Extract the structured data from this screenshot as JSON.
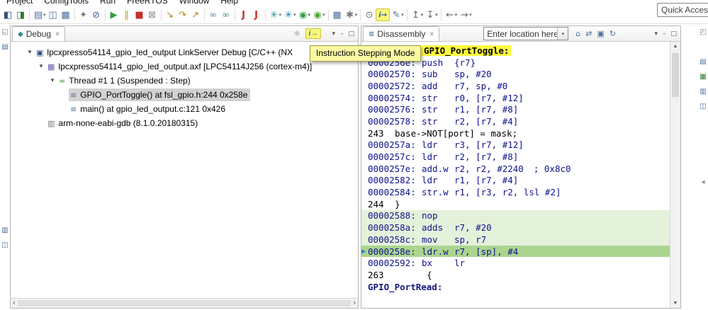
{
  "menu": {
    "items": [
      {
        "label": "Project"
      },
      {
        "label": "ConfigTools"
      },
      {
        "label": "Run"
      },
      {
        "label": "FreeRTOS"
      },
      {
        "label": "Window"
      },
      {
        "label": "Help"
      }
    ]
  },
  "quick_access": {
    "label": "Quick Access"
  },
  "glyphs": {
    "caret_down": "▾",
    "expanded": "▾",
    "close": "×",
    "scroll_left": "‹",
    "scroll_right": "›",
    "scroll_up": "▲",
    "scroll_down": "▼",
    "current_arrow": "▶",
    "debug_tab": "◆",
    "disassembly_tab": "≡",
    "dim_tool": "✱",
    "step_mode": "i→"
  },
  "window_buttons": [
    {
      "name": "view-menu",
      "glyph": "▾"
    },
    {
      "name": "minimize-view",
      "glyph": "–"
    },
    {
      "name": "maximize-view",
      "glyph": "□"
    }
  ],
  "main_toolbar": {
    "icons": [
      {
        "name": "open-debug-config",
        "glyph": "◧",
        "color": "#35517d"
      },
      {
        "name": "open-run-config",
        "glyph": "◨",
        "color": "#2e7d32"
      },
      {
        "name": "new-wizard",
        "glyph": "▤",
        "color": "#4a6fa0",
        "caret": true,
        "sep": true
      },
      {
        "name": "save",
        "glyph": "◫",
        "color": "#4a6fa0"
      },
      {
        "name": "save-all",
        "glyph": "▩",
        "color": "#4a6fa0"
      },
      {
        "name": "build",
        "glyph": "✦",
        "color": "#777777",
        "sep": true
      },
      {
        "name": "skip-all-breakpoints",
        "glyph": "⊘",
        "color": "#3b5ea8"
      },
      {
        "name": "resume",
        "glyph": "▶",
        "color": "#2f9e44",
        "sep": true
      },
      {
        "name": "suspend",
        "glyph": "‖",
        "color": "#caa21f"
      },
      {
        "name": "terminate",
        "glyph": "■",
        "color": "#c4302b"
      },
      {
        "name": "disconnect",
        "glyph": "⊠",
        "color": "#8a8a8a"
      },
      {
        "name": "step-into",
        "glyph": "↘",
        "color": "#b8860b",
        "sep": true
      },
      {
        "name": "step-over",
        "glyph": "↷",
        "color": "#b8860b"
      },
      {
        "name": "step-return",
        "glyph": "↗",
        "color": "#b8860b"
      },
      {
        "name": "link-with-editor",
        "glyph": "∞",
        "color": "#5f7d9c",
        "sep": true
      },
      {
        "name": "link-debug",
        "glyph": "∞",
        "color": "#3f8f6f"
      },
      {
        "name": "jlink-tool-1",
        "glyph": "J",
        "color": "#c4302b",
        "bold": true,
        "sep": true
      },
      {
        "name": "jlink-tool-2",
        "glyph": "J",
        "color": "#c4302b",
        "bold": true
      },
      {
        "name": "probe-discovery",
        "glyph": "✳",
        "color": "#148f8d",
        "caret": true,
        "sep": true
      },
      {
        "name": "firmware-config",
        "glyph": "✳",
        "color": "#0f7f9e",
        "caret": true
      },
      {
        "name": "gui-flash-tool",
        "glyph": "◉",
        "color": "#2f9e44",
        "caret": true
      },
      {
        "name": "quick-launch",
        "glyph": "◉",
        "color": "#51a832",
        "caret": true
      },
      {
        "name": "memory-tool",
        "glyph": "▦",
        "color": "#4a6fa0",
        "sep": true
      },
      {
        "name": "preferences",
        "glyph": "✱",
        "color": "#7a7a7a",
        "caret": true
      },
      {
        "name": "search",
        "glyph": "⊙",
        "color": "#6f6f6f",
        "sep": true
      },
      {
        "name": "instruction-stepping-mode",
        "glyph": "i→",
        "color": "#2b5fa5",
        "hl": true
      },
      {
        "name": "annotate",
        "glyph": "✎",
        "color": "#4a6fa0",
        "caret": true
      },
      {
        "name": "previous-annotation",
        "glyph": "↥",
        "color": "#666666",
        "caret": true,
        "sep": true
      },
      {
        "name": "next-annotation",
        "glyph": "↧",
        "color": "#666666",
        "caret": true
      },
      {
        "name": "back-history",
        "glyph": "←",
        "color": "#666666",
        "caret": true,
        "sep": true
      },
      {
        "name": "forward-history",
        "glyph": "→",
        "color": "#666666",
        "caret": true
      }
    ]
  },
  "rails": {
    "left_top": [
      {
        "name": "restore-views",
        "glyph": "◱",
        "color": "#6f7f8f"
      },
      {
        "name": "minimized-view-1",
        "glyph": "▤",
        "color": "#4a6fa0"
      }
    ],
    "left_bottom": [
      {
        "name": "minimized-view-2",
        "glyph": "▥",
        "color": "#4a6fa0"
      },
      {
        "name": "minimized-view-3",
        "glyph": "◫",
        "color": "#4a6fa0"
      }
    ],
    "right_top": [
      {
        "name": "restore-views",
        "glyph": "◰",
        "color": "#6f7f8f"
      }
    ],
    "right_views": [
      {
        "name": "minimized-outline",
        "glyph": "▤",
        "color": "#4a6fa0"
      },
      {
        "name": "minimized-registers",
        "glyph": "▦",
        "color": "#2e7d32"
      },
      {
        "name": "minimized-peripherals",
        "glyph": "▥",
        "color": "#4a6fa0"
      },
      {
        "name": "minimized-memory",
        "glyph": "◫",
        "color": "#4a6fa0"
      }
    ],
    "right_mid": [
      {
        "name": "restore-arrow",
        "glyph": "◂",
        "color": "#888888"
      }
    ]
  },
  "debug_view": {
    "tab_label": "Debug",
    "tree": [
      {
        "level": 0,
        "expanded": true,
        "icon": {
          "name": "launch-config-icon",
          "glyph": "▣",
          "color": "#2f4f7f"
        },
        "label": "lpcxpresso54114_gpio_led_output LinkServer Debug [C/C++ (NX"
      },
      {
        "level": 1,
        "expanded": true,
        "icon": {
          "name": "executable-icon",
          "glyph": "▦",
          "color": "#6a5ca8"
        },
        "label": "lpcxpresso54114_gpio_led_output.axf [LPC54114J256 (cortex-m4)]"
      },
      {
        "level": 2,
        "expanded": true,
        "icon": {
          "name": "thread-icon",
          "glyph": "≈",
          "color": "#2e8b2e"
        },
        "label": "Thread #1 1 (Suspended : Step)"
      },
      {
        "level": 3,
        "selected": true,
        "icon": {
          "name": "stack-frame-icon",
          "glyph": "≡",
          "color": "#4a6f9e"
        },
        "label": "GPIO_PortToggle() at fsl_gpio.h:244 0x258e"
      },
      {
        "level": 3,
        "icon": {
          "name": "stack-frame-icon",
          "glyph": "≡",
          "color": "#4a6f9e"
        },
        "label": "main() at gpio_led_output.c:121 0x426"
      },
      {
        "level": 1,
        "icon": {
          "name": "gdb-process-icon",
          "glyph": "▥",
          "color": "#777777"
        },
        "label": "arm-none-eabi-gdb (8.1.0.20180315)"
      }
    ]
  },
  "disassembly_view": {
    "tab_label": "Disassembly",
    "location_combo": {
      "placeholder": "Enter location here"
    },
    "header_icons": [
      {
        "name": "home",
        "glyph": "⌂"
      },
      {
        "name": "sync-with-debugger",
        "glyph": "⇄"
      },
      {
        "name": "track-pc",
        "glyph": "▣"
      },
      {
        "name": "refresh",
        "glyph": "↻"
      }
    ],
    "rows": [
      {
        "type": "label",
        "text": "GPIO_PortToggle:",
        "highlight": true,
        "indent": true
      },
      {
        "type": "asm",
        "addr": "0000256e:",
        "mnemonic": "push",
        "operands": "{r7}"
      },
      {
        "type": "asm",
        "addr": "00002570:",
        "mnemonic": "sub",
        "operands": "sp, #20"
      },
      {
        "type": "asm",
        "addr": "00002572:",
        "mnemonic": "add",
        "operands": "r7, sp, #0"
      },
      {
        "type": "asm",
        "addr": "00002574:",
        "mnemonic": "str",
        "operands": "r0, [r7, #12]"
      },
      {
        "type": "asm",
        "addr": "00002576:",
        "mnemonic": "str",
        "operands": "r1, [r7, #8]"
      },
      {
        "type": "asm",
        "addr": "00002578:",
        "mnemonic": "str",
        "operands": "r2, [r7, #4]"
      },
      {
        "type": "src",
        "line": "243",
        "text": "base->NOT[port] = mask;"
      },
      {
        "type": "asm",
        "addr": "0000257a:",
        "mnemonic": "ldr",
        "operands": "r3, [r7, #12]"
      },
      {
        "type": "asm",
        "addr": "0000257c:",
        "mnemonic": "ldr",
        "operands": "r2, [r7, #8]"
      },
      {
        "type": "asm",
        "addr": "0000257e:",
        "mnemonic": "add.w",
        "operands": "r2, r2, #2240",
        "comment": "; 0x8c0"
      },
      {
        "type": "asm",
        "addr": "00002582:",
        "mnemonic": "ldr",
        "operands": "r1, [r7, #4]"
      },
      {
        "type": "asm",
        "addr": "00002584:",
        "mnemonic": "str.w",
        "operands": "r1, [r3, r2, lsl #2]"
      },
      {
        "type": "src",
        "line": "244",
        "text": "}"
      },
      {
        "type": "asm",
        "addr": "00002588:",
        "mnemonic": "nop",
        "operands": "",
        "shaded": true
      },
      {
        "type": "asm",
        "addr": "0000258a:",
        "mnemonic": "adds",
        "operands": "r7, #20",
        "shaded": true
      },
      {
        "type": "asm",
        "addr": "0000258c:",
        "mnemonic": "mov",
        "operands": "sp, r7",
        "shaded": true
      },
      {
        "type": "asm",
        "addr": "0000258e:",
        "mnemonic": "ldr.w",
        "operands": "r7, [sp], #4",
        "current": true
      },
      {
        "type": "asm",
        "addr": "00002592:",
        "mnemonic": "bx",
        "operands": "lr"
      },
      {
        "type": "src",
        "line": "263",
        "text": "      {"
      },
      {
        "type": "label",
        "text": "GPIO_PortRead:"
      }
    ]
  },
  "tooltip": {
    "text": "Instruction Stepping Mode"
  },
  "colors": {
    "highlight_yellow": "#fbfb40",
    "tooltip_yellow": "#fbf9a3",
    "current_line_green": "#abd58f",
    "shade_green": "#e4f1db",
    "selection_gray": "#d2d2d2"
  }
}
